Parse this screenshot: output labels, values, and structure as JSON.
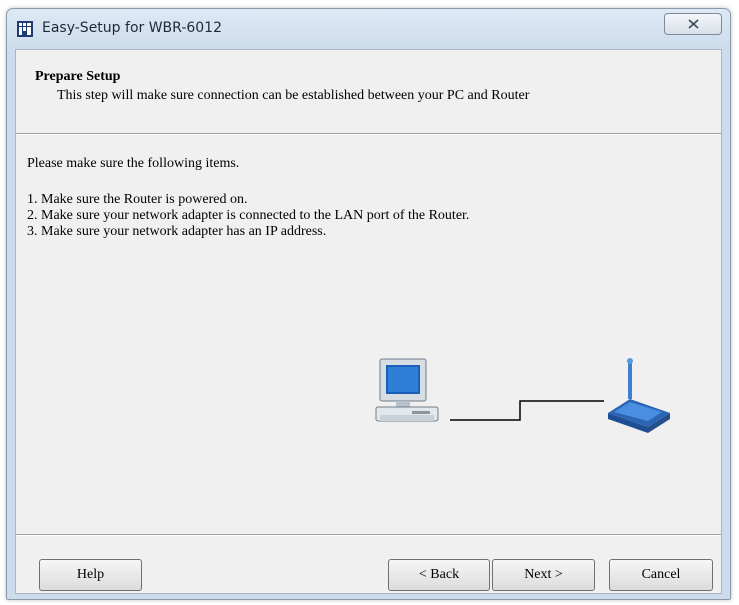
{
  "window": {
    "title": "Easy-Setup for WBR-6012",
    "close_icon": "close-icon"
  },
  "header": {
    "title": "Prepare Setup",
    "subtitle": "This step will make sure connection can be established between your PC and Router"
  },
  "content": {
    "intro": "Please make sure the following items.",
    "items": [
      "1. Make sure the Router is powered on.",
      "2. Make sure your network adapter is connected to the LAN port of the Router.",
      "3. Make sure your network adapter has an IP address."
    ]
  },
  "diagram": {
    "pc_icon": "computer-icon",
    "router_icon": "router-icon",
    "link": "connection-line"
  },
  "buttons": {
    "help": "Help",
    "back": "< Back",
    "next": "Next >",
    "cancel": "Cancel"
  },
  "colors": {
    "accent": "#3a7fc8",
    "router": "#3d7fd0"
  }
}
